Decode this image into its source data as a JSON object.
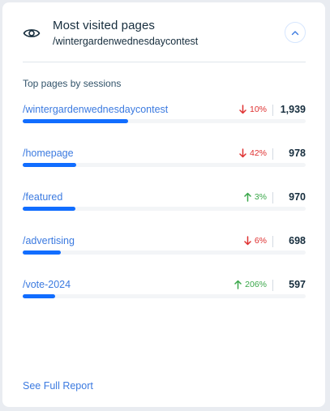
{
  "card": {
    "title": "Most visited pages",
    "subtitle": "/wintergardenwednesdaycontest",
    "header_icon": "eye-icon",
    "collapse_icon": "chevron-up-icon"
  },
  "section_title": "Top pages by sessions",
  "colors": {
    "link": "#3b7ae0",
    "bar": "#116dff",
    "down": "#df3131",
    "up": "#3aa74a"
  },
  "pages": [
    {
      "path": "/wintergardenwednesdaycontest",
      "direction": "down",
      "change": "10%",
      "sessions": "1,939",
      "share": 1.0
    },
    {
      "path": "/homepage",
      "direction": "down",
      "change": "42%",
      "sessions": "978",
      "share": 0.504
    },
    {
      "path": "/featured",
      "direction": "up",
      "change": "3%",
      "sessions": "970",
      "share": 0.5
    },
    {
      "path": "/advertising",
      "direction": "down",
      "change": "6%",
      "sessions": "698",
      "share": 0.36
    },
    {
      "path": "/vote-2024",
      "direction": "up",
      "change": "206%",
      "sessions": "597",
      "share": 0.308
    }
  ],
  "footer": {
    "full_report_label": "See Full Report"
  }
}
